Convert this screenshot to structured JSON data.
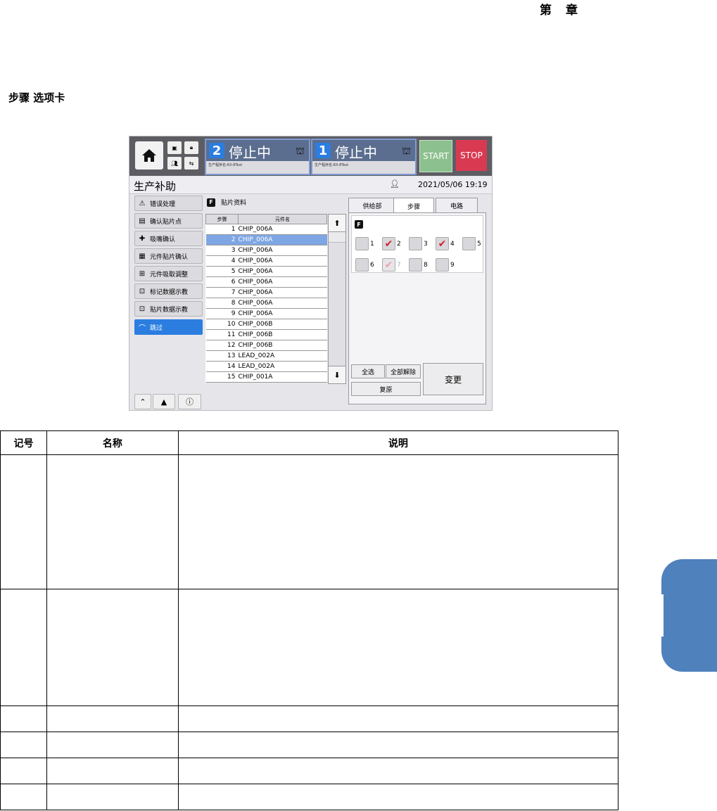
{
  "header": {
    "chapter_prefix": "第",
    "chapter_suffix": "章"
  },
  "section_title": "步骤 选项卡",
  "app": {
    "top": {
      "lane2": {
        "num": "2",
        "status": "停止中",
        "program": "生产程序名:RX-8Test"
      },
      "lane1": {
        "num": "1",
        "status": "停止中",
        "program": "生产程序名:RX-8Test"
      },
      "start": "START",
      "stop": "STOP"
    },
    "title": "生产补助",
    "datetime": "2021/05/06 19:19",
    "menu": [
      {
        "label": "错误处理"
      },
      {
        "label": "确认贴片点"
      },
      {
        "label": "吸嘴确认"
      },
      {
        "label": "元件贴片确认"
      },
      {
        "label": "元件吸取调整"
      },
      {
        "label": "标记数据示教"
      },
      {
        "label": "贴片数据示教"
      },
      {
        "label": "跳过"
      }
    ],
    "list_title": "贴片资料",
    "f_label": "F",
    "columns": [
      "步骤",
      "元件名"
    ],
    "rows": [
      [
        "1",
        "CHIP_006A"
      ],
      [
        "2",
        "CHIP_006A"
      ],
      [
        "3",
        "CHIP_006A"
      ],
      [
        "4",
        "CHIP_006A"
      ],
      [
        "5",
        "CHIP_006A"
      ],
      [
        "6",
        "CHIP_006A"
      ],
      [
        "7",
        "CHIP_006A"
      ],
      [
        "8",
        "CHIP_006A"
      ],
      [
        "9",
        "CHIP_006A"
      ],
      [
        "10",
        "CHIP_006B"
      ],
      [
        "11",
        "CHIP_006B"
      ],
      [
        "12",
        "CHIP_006B"
      ],
      [
        "13",
        "LEAD_002A"
      ],
      [
        "14",
        "LEAD_002A"
      ],
      [
        "15",
        "CHIP_001A"
      ]
    ],
    "tabs": [
      "供给部",
      "步骤",
      "电路"
    ],
    "checks": [
      {
        "n": "1",
        "checked": false
      },
      {
        "n": "2",
        "checked": true
      },
      {
        "n": "3",
        "checked": false
      },
      {
        "n": "4",
        "checked": true
      },
      {
        "n": "5",
        "checked": false
      },
      {
        "n": "6",
        "checked": false
      },
      {
        "n": "7",
        "checked": true
      },
      {
        "n": "8",
        "checked": false
      },
      {
        "n": "9",
        "checked": false
      }
    ],
    "buttons": {
      "select_all": "全选",
      "deselect_all": "全部解除",
      "restore": "复原",
      "change": "变更"
    }
  },
  "doc_table": {
    "headers": [
      "记号",
      "名称",
      "说明"
    ]
  }
}
